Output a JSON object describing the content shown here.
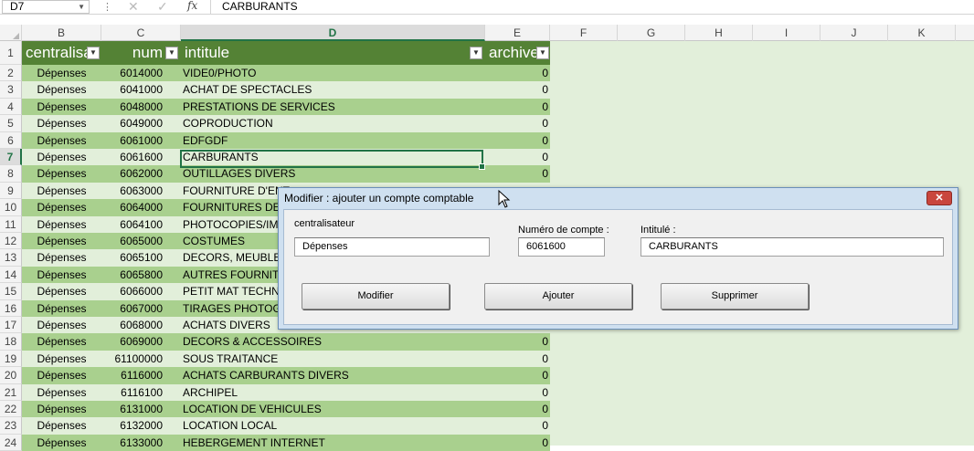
{
  "formula_bar": {
    "name_box": "D7",
    "cancel_icon": "✕",
    "enter_icon": "✓",
    "fx": "fx",
    "content": "CARBURANTS"
  },
  "columns": [
    "B",
    "C",
    "D",
    "E",
    "F",
    "G",
    "H",
    "I",
    "J",
    "K"
  ],
  "selected_column": "D",
  "table": {
    "headers": {
      "centralisateur": "centralisat",
      "num": "num",
      "intitule": "intitule",
      "archive": "archive"
    },
    "filter_icon": "▼",
    "rows": [
      {
        "row": "2",
        "centralisateur": "Dépenses",
        "num": "6014000",
        "intitule": "VIDE0/PHOTO",
        "archive": "0"
      },
      {
        "row": "3",
        "centralisateur": "Dépenses",
        "num": "6041000",
        "intitule": "ACHAT DE SPECTACLES",
        "archive": "0"
      },
      {
        "row": "4",
        "centralisateur": "Dépenses",
        "num": "6048000",
        "intitule": "PRESTATIONS DE SERVICES",
        "archive": "0"
      },
      {
        "row": "5",
        "centralisateur": "Dépenses",
        "num": "6049000",
        "intitule": "COPRODUCTION",
        "archive": "0"
      },
      {
        "row": "6",
        "centralisateur": "Dépenses",
        "num": "6061000",
        "intitule": "EDFGDF",
        "archive": "0"
      },
      {
        "row": "7",
        "centralisateur": "Dépenses",
        "num": "6061600",
        "intitule": "CARBURANTS",
        "archive": "0"
      },
      {
        "row": "8",
        "centralisateur": "Dépenses",
        "num": "6062000",
        "intitule": "OUTILLAGES DIVERS",
        "archive": "0"
      },
      {
        "row": "9",
        "centralisateur": "Dépenses",
        "num": "6063000",
        "intitule": "FOURNITURE D'ENT",
        "archive": ""
      },
      {
        "row": "10",
        "centralisateur": "Dépenses",
        "num": "6064000",
        "intitule": "FOURNITURES DE B",
        "archive": ""
      },
      {
        "row": "11",
        "centralisateur": "Dépenses",
        "num": "6064100",
        "intitule": "PHOTOCOPIES/IMP",
        "archive": ""
      },
      {
        "row": "12",
        "centralisateur": "Dépenses",
        "num": "6065000",
        "intitule": "COSTUMES",
        "archive": ""
      },
      {
        "row": "13",
        "centralisateur": "Dépenses",
        "num": "6065100",
        "intitule": "DECORS, MEUBLES",
        "archive": ""
      },
      {
        "row": "14",
        "centralisateur": "Dépenses",
        "num": "6065800",
        "intitule": "AUTRES FOURNITU",
        "archive": ""
      },
      {
        "row": "15",
        "centralisateur": "Dépenses",
        "num": "6066000",
        "intitule": "PETIT MAT TECHNI",
        "archive": ""
      },
      {
        "row": "16",
        "centralisateur": "Dépenses",
        "num": "6067000",
        "intitule": "TIRAGES PHOTOGR",
        "archive": ""
      },
      {
        "row": "17",
        "centralisateur": "Dépenses",
        "num": "6068000",
        "intitule": "ACHATS DIVERS",
        "archive": ""
      },
      {
        "row": "18",
        "centralisateur": "Dépenses",
        "num": "6069000",
        "intitule": "DECORS & ACCESSOIRES",
        "archive": "0"
      },
      {
        "row": "19",
        "centralisateur": "Dépenses",
        "num": "61100000",
        "intitule": "SOUS TRAITANCE",
        "archive": "0"
      },
      {
        "row": "20",
        "centralisateur": "Dépenses",
        "num": "6116000",
        "intitule": "ACHATS CARBURANTS DIVERS",
        "archive": "0"
      },
      {
        "row": "21",
        "centralisateur": "Dépenses",
        "num": "6116100",
        "intitule": "ARCHIPEL",
        "archive": "0"
      },
      {
        "row": "22",
        "centralisateur": "Dépenses",
        "num": "6131000",
        "intitule": "LOCATION DE VEHICULES",
        "archive": "0"
      },
      {
        "row": "23",
        "centralisateur": "Dépenses",
        "num": "6132000",
        "intitule": "LOCATION LOCAL",
        "archive": "0"
      },
      {
        "row": "24",
        "centralisateur": "Dépenses",
        "num": "6133000",
        "intitule": "HEBERGEMENT INTERNET",
        "archive": "0"
      }
    ]
  },
  "dialog": {
    "title": "Modifier : ajouter un compte comptable",
    "close_icon": "✕",
    "fields": {
      "centralisateur_label": "centralisateur",
      "centralisateur_value": "Dépenses",
      "numero_label": "Numéro de compte :",
      "numero_value": "6061600",
      "intitule_label": "Intitulé :",
      "intitule_value": "CARBURANTS"
    },
    "buttons": {
      "modifier": "Modifier",
      "ajouter": "Ajouter",
      "supprimer": "Supprimer"
    }
  },
  "colors": {
    "header_green": "#548235",
    "band_green": "#a9d08e",
    "light_green": "#e2efda",
    "selection": "#217346"
  }
}
